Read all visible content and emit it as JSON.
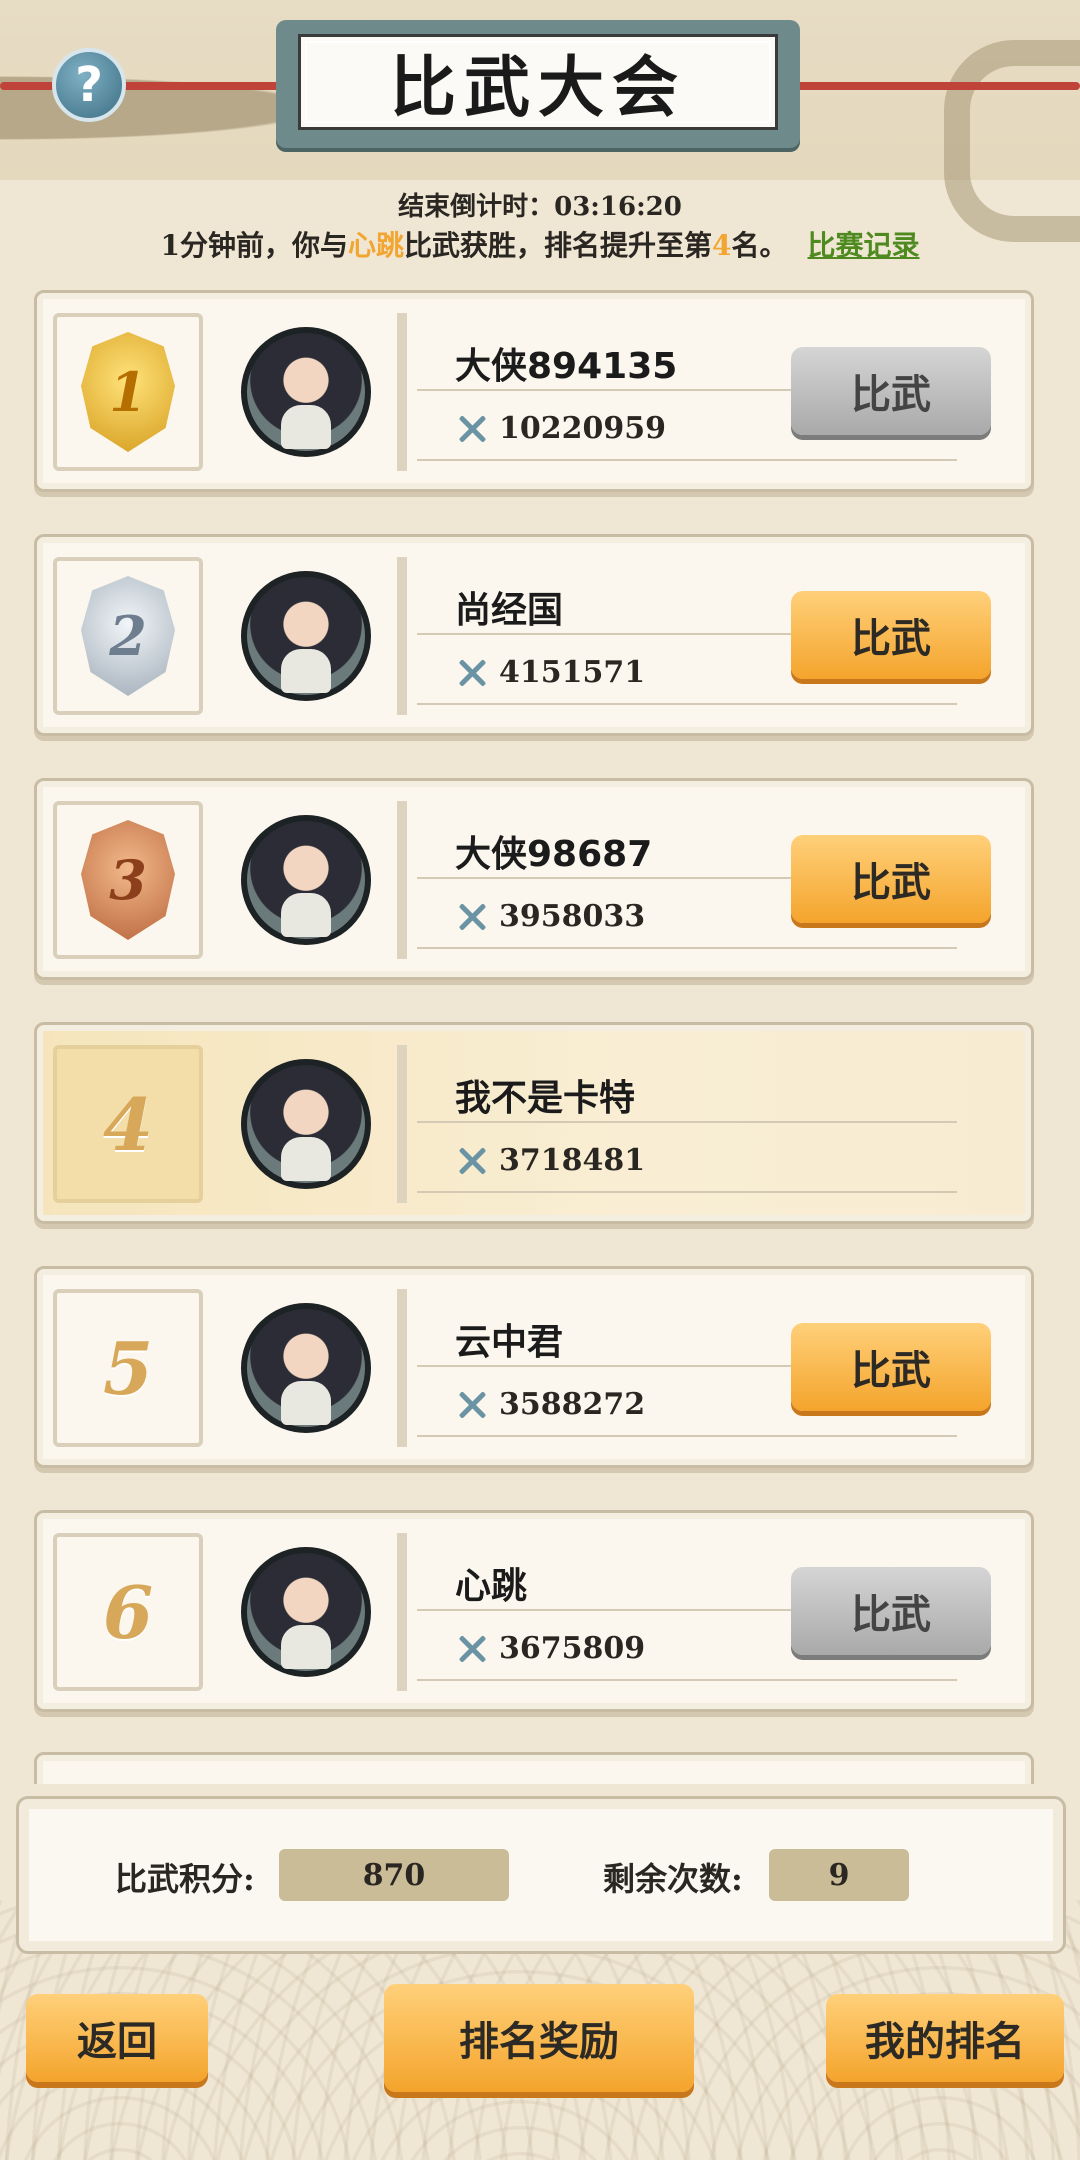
{
  "header": {
    "title": "比武大会",
    "help_label": "?"
  },
  "countdown": {
    "label": "结束倒计时：",
    "time": "03:16:20"
  },
  "notice": {
    "prefix": "1分钟前，你与",
    "opponent": "心跳",
    "middle": "比武获胜，排名提升至第",
    "rank": "4",
    "suffix": "名。",
    "record_link": "比赛记录"
  },
  "ranking": [
    {
      "rank": "1",
      "name": "大侠894135",
      "power": "10220959",
      "button": "比武",
      "button_state": "disabled"
    },
    {
      "rank": "2",
      "name": "尚经国",
      "power": "4151571",
      "button": "比武",
      "button_state": "enabled"
    },
    {
      "rank": "3",
      "name": "大侠98687",
      "power": "3958033",
      "button": "比武",
      "button_state": "enabled"
    },
    {
      "rank": "4",
      "name": "我不是卡特",
      "power": "3718481",
      "button": "",
      "button_state": "self"
    },
    {
      "rank": "5",
      "name": "云中君",
      "power": "3588272",
      "button": "比武",
      "button_state": "enabled"
    },
    {
      "rank": "6",
      "name": "心跳",
      "power": "3675809",
      "button": "比武",
      "button_state": "disabled"
    }
  ],
  "stats": {
    "score_label": "比武积分:",
    "score_value": "870",
    "remaining_label": "剩余次数:",
    "remaining_value": "9"
  },
  "bottom": {
    "back": "返回",
    "rewards": "排名奖励",
    "my_rank": "我的排名"
  },
  "colors": {
    "accent_orange": "#f4a42c",
    "highlight": "#f3a531",
    "link_green": "#4e8a1f"
  }
}
